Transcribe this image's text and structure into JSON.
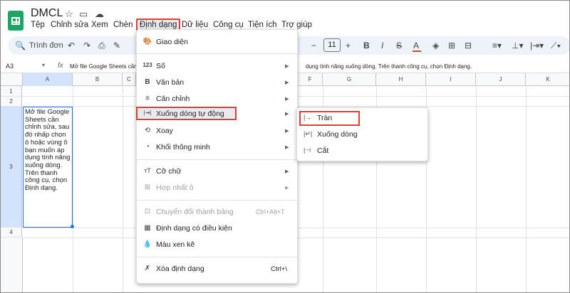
{
  "app": {
    "title": "DMCL"
  },
  "menubar": [
    "Tệp",
    "Chỉnh sửa",
    "Xem",
    "Chèn",
    "Định dạng",
    "Dữ liệu",
    "Công cụ",
    "Tiện ích",
    "Trợ giúp"
  ],
  "toolbar": {
    "search_placeholder": "Trình đơn",
    "font_size": "11"
  },
  "formula": {
    "cell_ref": "A3",
    "fx": "fx",
    "text_left": "Mở file Google Sheets cần",
    "text_right": "dụng tính năng xuống dòng. Trên thanh công cụ, chọn Định dạng."
  },
  "columns": [
    "A",
    "B",
    "C",
    "D",
    "E",
    "F",
    "G",
    "H",
    "I",
    "J",
    "K"
  ],
  "rows": [
    "1",
    "2",
    "3",
    "4"
  ],
  "cell_a3": "Mở file Google Sheets cần chỉnh sửa, sau đó nhấp chọn ô hoặc vùng ô bạn muốn áp dụng tính năng xuống dòng. Trên thanh công cụ, chọn Định dạng.",
  "format_menu": [
    {
      "icon": "🎨",
      "label": "Giao diện"
    },
    {
      "icon": "123",
      "label": "Số"
    },
    {
      "icon": "B",
      "label": "Văn bản"
    },
    {
      "icon": "≡",
      "label": "Căn chỉnh"
    },
    {
      "icon": "|⇥|",
      "label": "Xuống dòng tự động"
    },
    {
      "icon": "⟲",
      "label": "Xoay"
    },
    {
      "icon": "◔",
      "label": "Khối thông minh"
    },
    {
      "icon": "тT",
      "label": "Cỡ chữ"
    },
    {
      "icon": "⊞",
      "label": "Hợp nhất ô"
    },
    {
      "icon": "⊡",
      "label": "Chuyển đổi thành bảng",
      "shortcut": "Ctrl+Alt+T"
    },
    {
      "icon": "▦",
      "label": "Định dạng có điều kiện"
    },
    {
      "icon": "💧",
      "label": "Màu xen kẽ"
    },
    {
      "icon": "✗",
      "label": "Xóa định dạng",
      "shortcut": "Ctrl+\\"
    }
  ],
  "wrap_submenu": [
    {
      "icon": "|→",
      "label": "Tràn"
    },
    {
      "icon": "|↵|",
      "label": "Xuống dòng"
    },
    {
      "icon": "|⊣",
      "label": "Cắt"
    }
  ],
  "colors": {
    "brand": "#1fa463",
    "highlight_border": "#e53935",
    "selection": "#1a73e8"
  }
}
